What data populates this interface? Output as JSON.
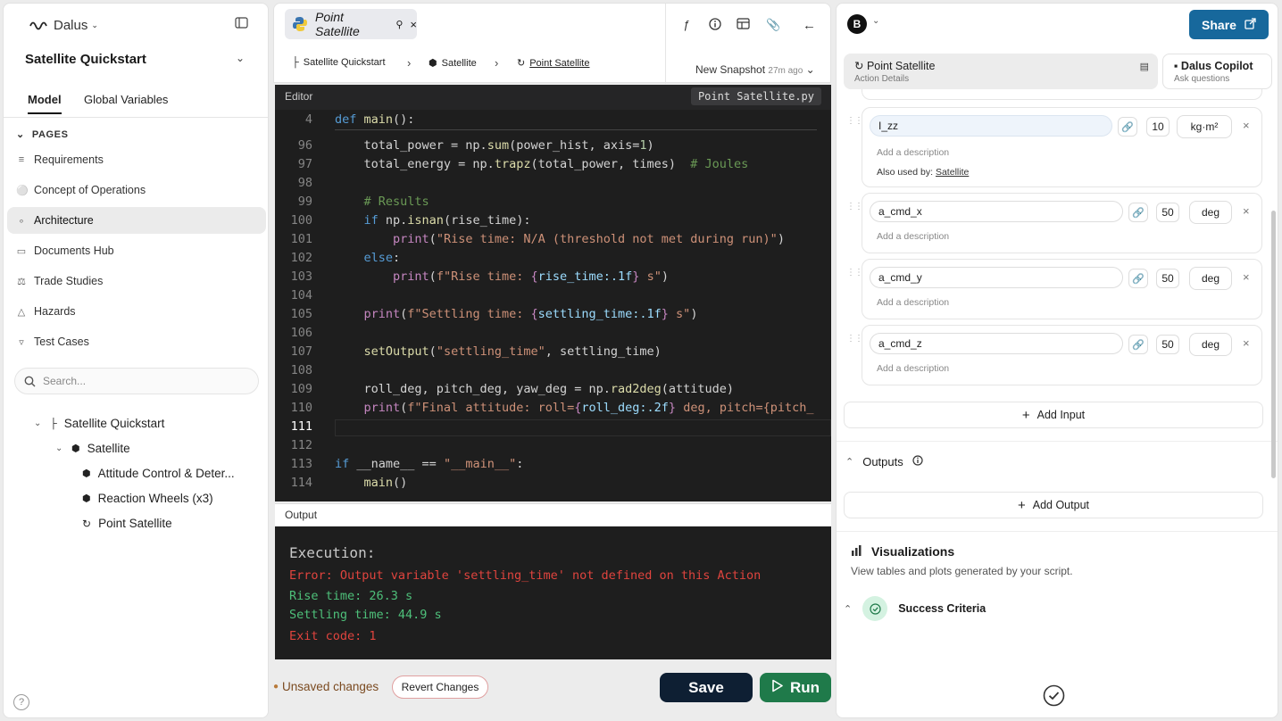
{
  "sidebar": {
    "logo": "Dalus",
    "project": "Satellite Quickstart",
    "tabs": [
      "Model",
      "Global Variables"
    ],
    "pages_header": "PAGES",
    "pages": [
      "Requirements",
      "Concept of Operations",
      "Architecture",
      "Documents Hub",
      "Trade Studies",
      "Hazards",
      "Test Cases"
    ],
    "selected_page": "Architecture",
    "search_placeholder": "Search...",
    "tree": [
      "Satellite Quickstart",
      "Satellite",
      "Attitude Control & Deter...",
      "Reaction Wheels (x3)",
      "Point Satellite"
    ],
    "help": "?"
  },
  "editor_header": {
    "file_tab": "Point Satellite",
    "breadcrumb": [
      "Satellite Quickstart",
      "Satellite",
      "Point Satellite"
    ],
    "snapshot": "New Snapshot",
    "snapshot_time": "27m ago"
  },
  "editor": {
    "title": "Editor",
    "filename": "Point Satellite.py",
    "lines": [
      "4",
      "96",
      "97",
      "98",
      "99",
      "100",
      "101",
      "102",
      "103",
      "104",
      "105",
      "106",
      "107",
      "108",
      "109",
      "110",
      "111",
      "112",
      "113",
      "114"
    ],
    "code": {
      "l4": "def main():",
      "l96": "    total_power = np.sum(power_hist, axis=1)",
      "l97": "    total_energy = np.trapz(total_power, times)  # Joules",
      "l99": "    # Results",
      "l100": "    if np.isnan(rise_time):",
      "l101": "        print(\"Rise time: N/A (threshold not met during run)\")",
      "l102": "    else:",
      "l103": "        print(f\"Rise time: {rise_time:.1f} s\")",
      "l105": "    print(f\"Settling time: {settling_time:.1f} s\")",
      "l107": "    setOutput(\"settling_time\", settling_time)",
      "l109": "    roll_deg, pitch_deg, yaw_deg = np.rad2deg(attitude)",
      "l110": "    print(f\"Final attitude: roll={roll_deg:.2f} deg, pitch={pitch_",
      "l113": "if __name__ == \"__main__\":",
      "l114": "    main()"
    }
  },
  "output": {
    "title": "Output",
    "lines": [
      "Execution:",
      "Error: Output variable 'settling_time' not defined on this Action",
      "Rise time: 26.3 s",
      "Settling time: 44.9 s",
      "Exit code: 1"
    ],
    "colors": {
      "heading": "#c8c8c8",
      "error": "#e0443e",
      "ok": "#4ec07a"
    }
  },
  "footer": {
    "unsaved": "Unsaved changes",
    "revert": "Revert Changes",
    "save": "Save",
    "run": "Run"
  },
  "right": {
    "avatar": "B",
    "share": "Share",
    "tab_action": "Point Satellite",
    "tab_action_sub": "Action Details",
    "tab_copilot": "Dalus Copilot",
    "tab_copilot_sub": "Ask questions",
    "inputs": [
      {
        "name": "I_zz",
        "value": "10",
        "unit": "kg·m²",
        "desc": "Add a description",
        "used_by_label": "Also used by:",
        "used_by": "Satellite"
      },
      {
        "name": "a_cmd_x",
        "value": "50",
        "unit": "deg",
        "desc": "Add a description"
      },
      {
        "name": "a_cmd_y",
        "value": "50",
        "unit": "deg",
        "desc": "Add a description"
      },
      {
        "name": "a_cmd_z",
        "value": "50",
        "unit": "deg",
        "desc": "Add a description"
      }
    ],
    "add_input": "Add Input",
    "outputs_label": "Outputs",
    "add_output": "Add Output",
    "viz_title": "Visualizations",
    "viz_sub": "View tables and plots generated by your script.",
    "success": "Success Criteria",
    "accent": "#17689c"
  }
}
